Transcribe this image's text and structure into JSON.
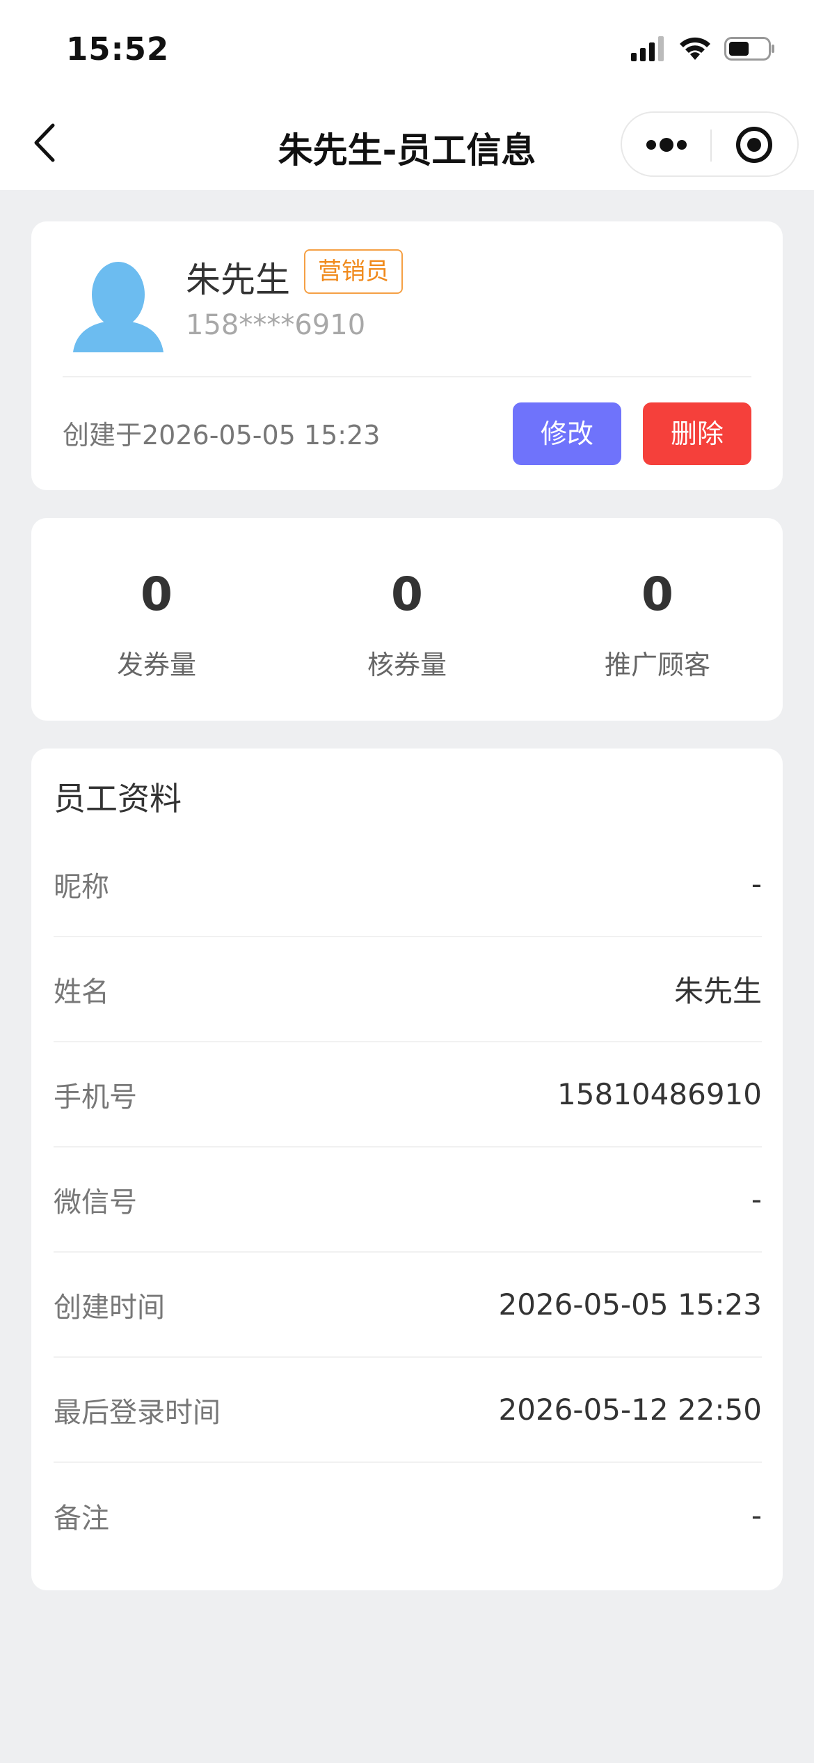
{
  "status_bar": {
    "time": "15:52"
  },
  "nav": {
    "title": "朱先生-员工信息"
  },
  "profile": {
    "name": "朱先生",
    "role_tag": "营销员",
    "phone_masked": "158****6910",
    "created": "创建于2026-05-05 15:23",
    "edit_label": "修改",
    "delete_label": "删除"
  },
  "stats": [
    {
      "value": "0",
      "label": "发券量"
    },
    {
      "value": "0",
      "label": "核券量"
    },
    {
      "value": "0",
      "label": "推广顾客"
    }
  ],
  "info": {
    "title": "员工资料",
    "rows": [
      {
        "label": "昵称",
        "value": "-"
      },
      {
        "label": "姓名",
        "value": "朱先生"
      },
      {
        "label": "手机号",
        "value": "15810486910"
      },
      {
        "label": "微信号",
        "value": "-"
      },
      {
        "label": "创建时间",
        "value": "2026-05-05 15:23"
      },
      {
        "label": "最后登录时间",
        "value": "2026-05-12 22:50"
      },
      {
        "label": "备注",
        "value": "-"
      }
    ]
  },
  "colors": {
    "accent_edit": "#6f73fb",
    "accent_delete": "#f5403b",
    "tag_orange": "#f08a1c",
    "avatar_blue": "#6cbcf0"
  }
}
